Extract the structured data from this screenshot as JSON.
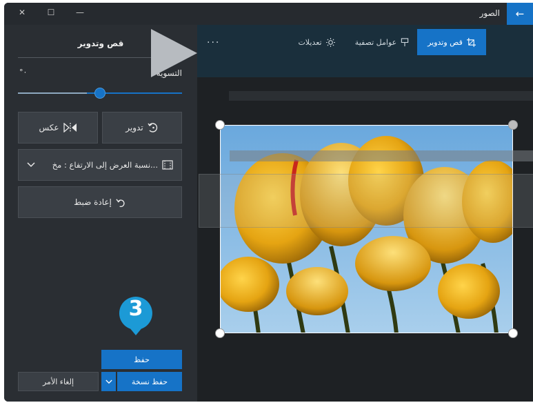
{
  "window": {
    "title": "الصور",
    "back_icon": "←",
    "minimize_icon": "—",
    "maximize_icon": "☐",
    "close_icon": "✕"
  },
  "toolbar": {
    "tabs": [
      {
        "label": "قص وتدوير",
        "icon": "crop-icon",
        "active": true
      },
      {
        "label": "عوامل تصفية",
        "icon": "filter-icon",
        "active": false
      },
      {
        "label": "تعديلات",
        "icon": "brightness-icon",
        "active": false
      }
    ],
    "more_label": "..."
  },
  "panel": {
    "title": "قص وتدوير",
    "straighten_label": "التسوية",
    "straighten_value": "°٠",
    "rotate_label": "تدوير",
    "flip_label": "عكس",
    "aspect_label": "نسبة العرض إلى الارتفاع : مخ...",
    "reset_label": "إعادة ضبط",
    "save_label": "حفظ",
    "save_copy_label": "حفظ نسخة",
    "cancel_label": "إلغاء الأمر"
  },
  "callout": {
    "number": "3"
  },
  "colors": {
    "accent": "#1673c7",
    "badge": "#1c9ad6"
  }
}
